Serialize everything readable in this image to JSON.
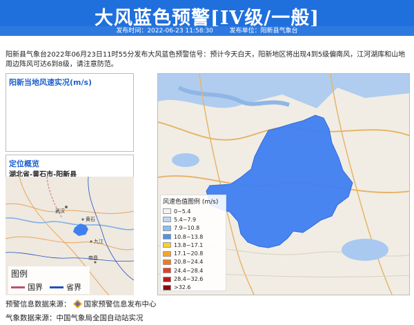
{
  "header": {
    "title": "大风蓝色预警[IV级/一般]",
    "publish_time_label": "发布时间：2022-06-23 11:58:30",
    "publisher_label": "发布单位：阳新县气象台"
  },
  "description": "阳新县气象台2022年06月23日11时55分发布大风蓝色预警信号：预计今天白天，阳新地区将出现4到5级偏南风，江河湖库和山地周边阵风可达6到8级，请注意防范。",
  "wind_panel": {
    "title": "阳新当地风速实况(m/s)"
  },
  "location_panel": {
    "title": "定位概览",
    "region": "湖北省-黄石市-阳新县"
  },
  "mini_map": {
    "labels": [
      "武汉",
      "黄石",
      "九江",
      "南昌"
    ],
    "legend_title": "图例",
    "legend_items": [
      {
        "label": "国界",
        "color": "#c0506a"
      },
      {
        "label": "省界",
        "color": "#2050c0"
      }
    ]
  },
  "map": {
    "warning_fill": "#3f7ff0",
    "legend": {
      "title": "风速色值图例 (m/s)",
      "items": [
        {
          "label": "0~5.4",
          "color": "#f2f2f2"
        },
        {
          "label": "5.4~7.9",
          "color": "#bcd7f2"
        },
        {
          "label": "7.9~10.8",
          "color": "#8bbdf0"
        },
        {
          "label": "10.8~13.8",
          "color": "#4f93e8"
        },
        {
          "label": "13.8~17.1",
          "color": "#f5d033"
        },
        {
          "label": "17.1~20.8",
          "color": "#f5a623"
        },
        {
          "label": "20.8~24.4",
          "color": "#f07b1e"
        },
        {
          "label": "24.4~28.4",
          "color": "#e0402a"
        },
        {
          "label": "28.4~32.6",
          "color": "#c01818"
        },
        {
          "label": ">32.6",
          "color": "#8b0a0a"
        }
      ]
    }
  },
  "footer": {
    "source1_label": "预警信息数据来源：",
    "source1_value": "国家预警信息发布中心",
    "source2": "气象数据来源：中国气象局全国自动站实况"
  }
}
